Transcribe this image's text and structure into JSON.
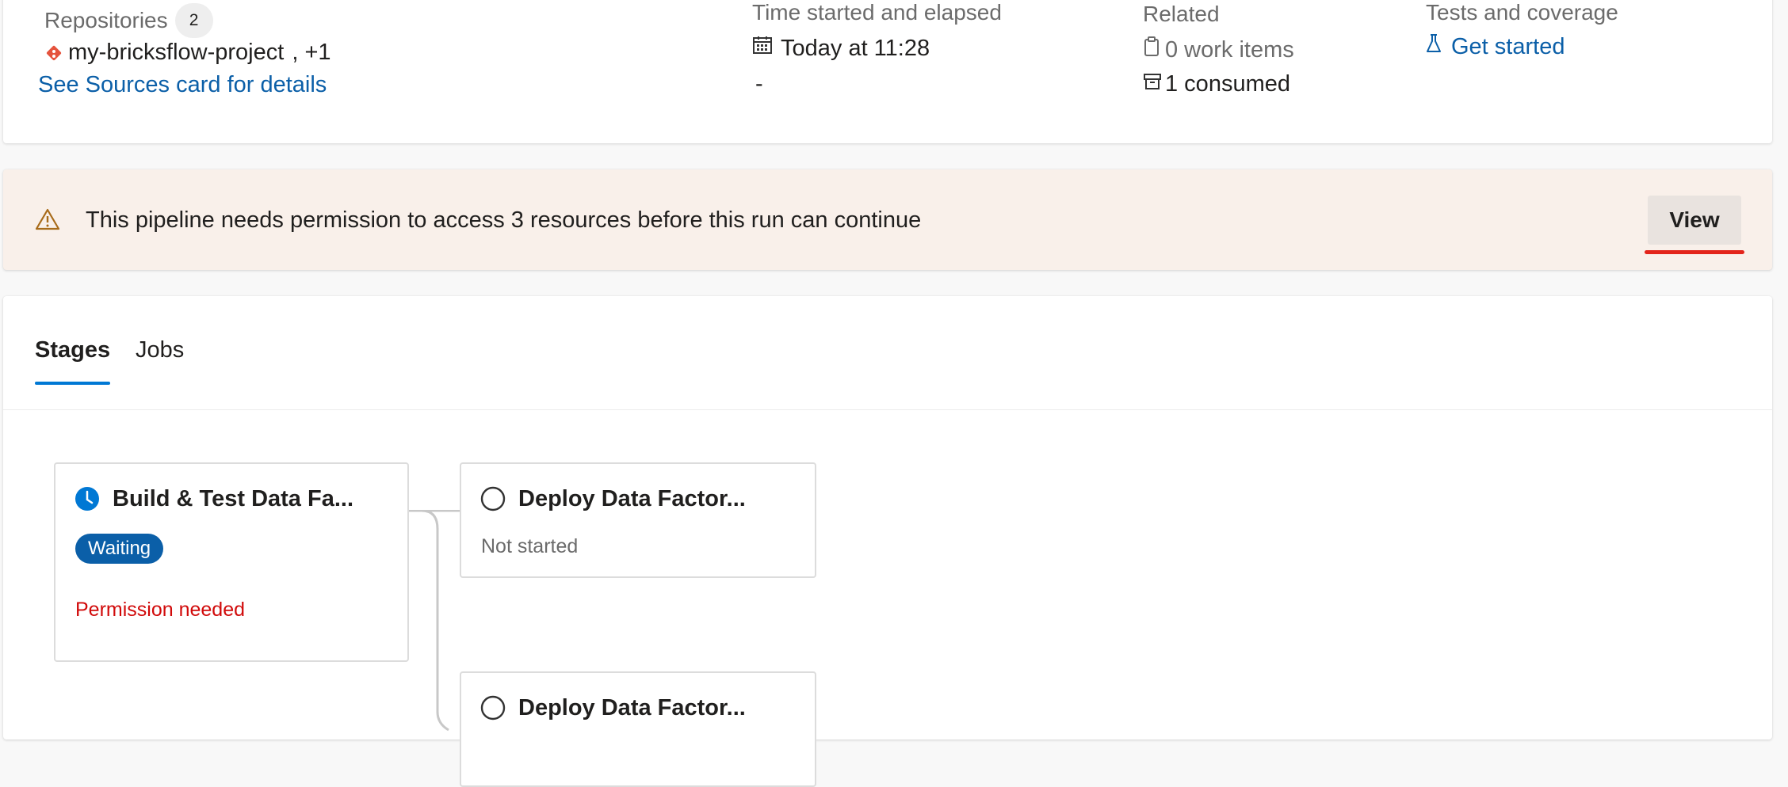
{
  "summary": {
    "repositories_label": "Repositories",
    "repositories_count": "2",
    "repo_name": "my-bricksflow-project",
    "repo_extra": ", +1",
    "sources_link": "See Sources card for details",
    "time_label": "Time started and elapsed",
    "time_started": "Today at 11:28",
    "time_elapsed": "-",
    "related_label": "Related",
    "work_items": "0 work items",
    "consumed": "1 consumed",
    "tests_label": "Tests and coverage",
    "tests_link": "Get started"
  },
  "banner": {
    "message": "This pipeline needs permission to access 3 resources before this run can continue",
    "button_label": "View",
    "warning_color": "#a86b1a"
  },
  "tabs": {
    "stages": "Stages",
    "jobs": "Jobs"
  },
  "stages": [
    {
      "title": "Build & Test Data Fa...",
      "status": "Waiting",
      "note": "Permission needed"
    },
    {
      "title": "Deploy Data Factor...",
      "note": "Not started"
    },
    {
      "title": "Deploy Data Factor..."
    }
  ],
  "colors": {
    "accent": "#0078d4",
    "link": "#0b5fa8",
    "error": "#d10a0a",
    "git": "#e5533d"
  }
}
